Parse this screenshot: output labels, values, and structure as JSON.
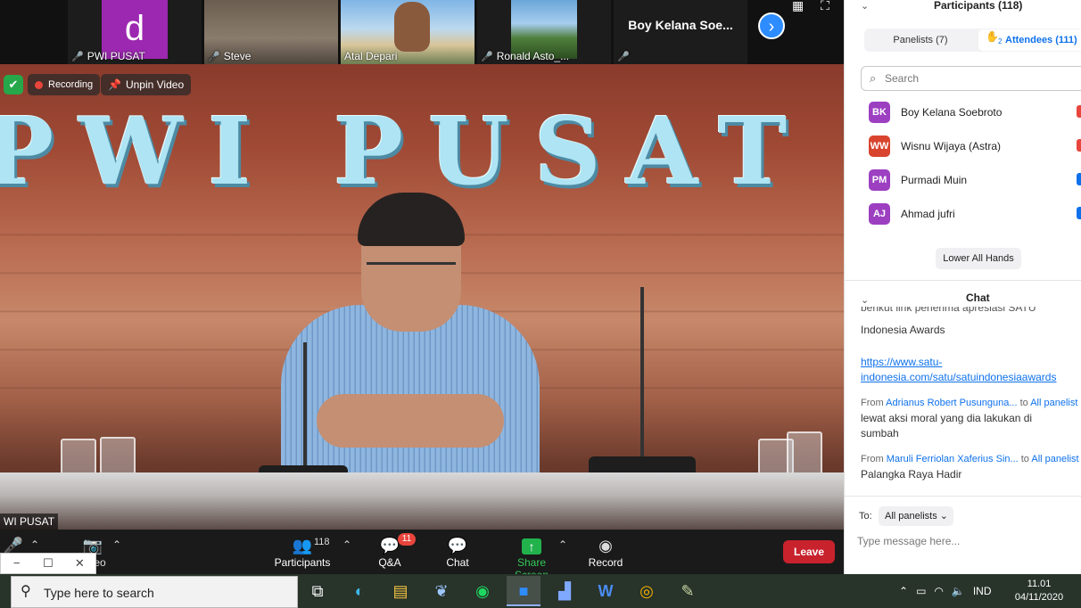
{
  "colors": {
    "zoom_blue": "#0e71eb",
    "leave_red": "#c8222d",
    "share_green": "#22b24c",
    "taskbar": "#28332a"
  },
  "thumbnails": [
    {
      "letter": "d",
      "name": "PWI PUSAT",
      "mic": "muted"
    },
    {
      "name": "Steve",
      "mic": "muted"
    },
    {
      "name": "Atal Depari",
      "mic": "on"
    },
    {
      "name": "Ronald Asto_...",
      "mic": "muted"
    },
    {
      "big_name": "Boy Kelana Soe...",
      "mic": "muted"
    }
  ],
  "icons": {
    "mic_off": "🎤",
    "next": "›",
    "grid": "▦",
    "fullscreen": "⛶",
    "shield": "✔",
    "pin": "📌",
    "collapse": "⌄",
    "search": "⌕",
    "hand": "✋",
    "participants": "👥",
    "qa": "💬",
    "chat": "💬",
    "share": "↑",
    "record": "◉",
    "caret_up": "⌃",
    "mute": "🎤",
    "video_off": "📷",
    "minimize": "−",
    "maximize": "☐",
    "close": "✕",
    "tb_search": "⚲",
    "chevron_down": "⌄"
  },
  "speaker": {
    "sign_text": "PWI PUSAT",
    "name": "WI PUSAT",
    "recording_label": "Recording",
    "unpin_label": "Unpin Video"
  },
  "toolbar": {
    "video_label": "eo",
    "participants_label": "Participants",
    "participants_count": "118",
    "qa_label": "Q&A",
    "qa_badge": "11",
    "chat_label": "Chat",
    "share_label": "Share Screen",
    "record_label": "Record",
    "leave_label": "Leave"
  },
  "participants_panel": {
    "title": "Participants (118)",
    "tab_panelists": "Panelists (7)",
    "tab_attendees": "Attendees (111)",
    "raised_hands": "2",
    "search_placeholder": "Search",
    "rows": [
      {
        "initials": "BK",
        "name": "Boy Kelana Soebroto",
        "color": "#9c3fc1",
        "status_color": "#e8453c"
      },
      {
        "initials": "WW",
        "name": "Wisnu Wijaya (Astra)",
        "color": "#d9442e",
        "status_color": "#e8453c"
      },
      {
        "initials": "PM",
        "name": "Purmadi Muin",
        "color": "#9c3fc1",
        "status_color": "#0e71eb"
      },
      {
        "initials": "AJ",
        "name": "Ahmad jufri",
        "color": "#9c3fc1",
        "status_color": "#0e71eb"
      }
    ],
    "lower_hands": "Lower All Hands"
  },
  "chat_panel": {
    "title": "Chat",
    "cut_line": "berikut link penerima apresiasi SATU",
    "messages": [
      {
        "lines": [
          "Indonesia Awards"
        ]
      },
      {
        "link": [
          "https://www.satu-",
          "indonesia.com/satu/satuindonesiaawards"
        ]
      },
      {
        "from_label": "From",
        "from": "Adrianus Robert Pusunguna...",
        "to_label": "to",
        "to": "All panelist",
        "lines": [
          "lewat aksi moral yang dia lakukan di",
          "sumbah"
        ]
      },
      {
        "from_label": "From",
        "from": "Maruli Ferriolan Xaferius Sin...",
        "to_label": "to",
        "to": "All panelist",
        "lines": [
          "Palangka Raya Hadir"
        ]
      }
    ],
    "to_label": "To:",
    "to_value": "All panelists",
    "input_placeholder": "Type message here..."
  },
  "taskbar": {
    "search_placeholder": "Type here to search",
    "apps": [
      {
        "name": "task-view",
        "glyph": "⧉"
      },
      {
        "name": "edge",
        "glyph": "◐"
      },
      {
        "name": "file-explorer",
        "glyph": "▤"
      },
      {
        "name": "app-feather",
        "glyph": "❦"
      },
      {
        "name": "spotify",
        "glyph": "◉"
      },
      {
        "name": "zoom",
        "glyph": "■"
      },
      {
        "name": "app-print",
        "glyph": "▟"
      },
      {
        "name": "word",
        "glyph": "W"
      },
      {
        "name": "chrome",
        "glyph": "◎"
      },
      {
        "name": "paint",
        "glyph": "✎"
      }
    ],
    "tray_language": "IND",
    "tray_icons": [
      "⌃",
      "▭",
      "◠",
      "🔈"
    ],
    "time": "11.01",
    "date": "04/11/2020"
  }
}
